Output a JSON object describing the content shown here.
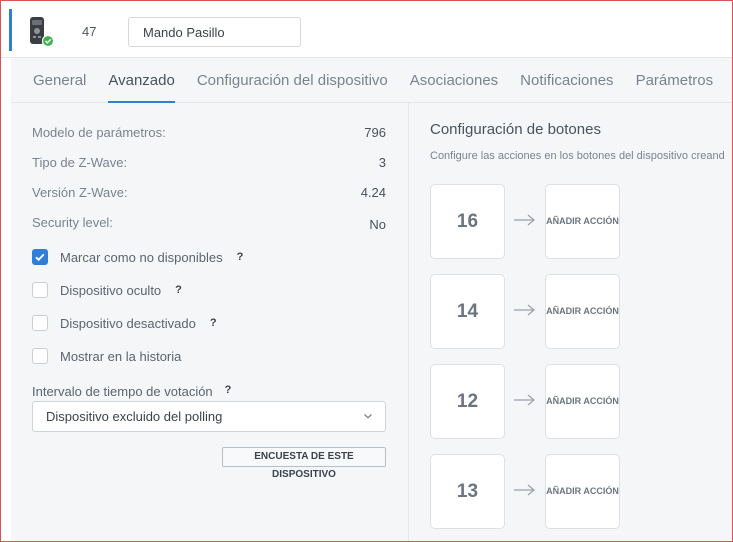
{
  "header": {
    "device_id": "47",
    "device_name": "Mando Pasillo"
  },
  "tabs": [
    {
      "label": "General"
    },
    {
      "label": "Avanzado"
    },
    {
      "label": "Configuración del dispositivo"
    },
    {
      "label": "Asociaciones"
    },
    {
      "label": "Notificaciones"
    },
    {
      "label": "Parámetros"
    }
  ],
  "active_tab": "Avanzado",
  "properties": [
    {
      "label": "Modelo de parámetros:",
      "value": "796"
    },
    {
      "label": "Tipo de Z-Wave:",
      "value": "3"
    },
    {
      "label": "Versión Z-Wave:",
      "value": "4.24"
    },
    {
      "label": "Security level:",
      "value": "No"
    }
  ],
  "checkboxes": [
    {
      "label": "Marcar como no disponibles",
      "checked": true,
      "help": "?"
    },
    {
      "label": "Dispositivo oculto",
      "checked": false,
      "help": "?"
    },
    {
      "label": "Dispositivo desactivado",
      "checked": false,
      "help": "?"
    },
    {
      "label": "Mostrar en la historia",
      "checked": false
    }
  ],
  "polling": {
    "label": "Intervalo de tiempo de votación",
    "help": "?",
    "selected": "Dispositivo excluido del polling",
    "button": "ENCUESTA DE ESTE DISPOSITIVO"
  },
  "buttons_config": {
    "title": "Configuración de botones",
    "description": "Configure las acciones en los botones del dispositivo creand",
    "buttons": [
      {
        "number": "16",
        "action": "AÑADIR ACCIÓN"
      },
      {
        "number": "14",
        "action": "AÑADIR ACCIÓN"
      },
      {
        "number": "12",
        "action": "AÑADIR ACCIÓN"
      },
      {
        "number": "13",
        "action": "AÑADIR ACCIÓN"
      }
    ]
  },
  "colors": {
    "accent": "#2f7fd8",
    "status_ok": "#3cb44b"
  }
}
